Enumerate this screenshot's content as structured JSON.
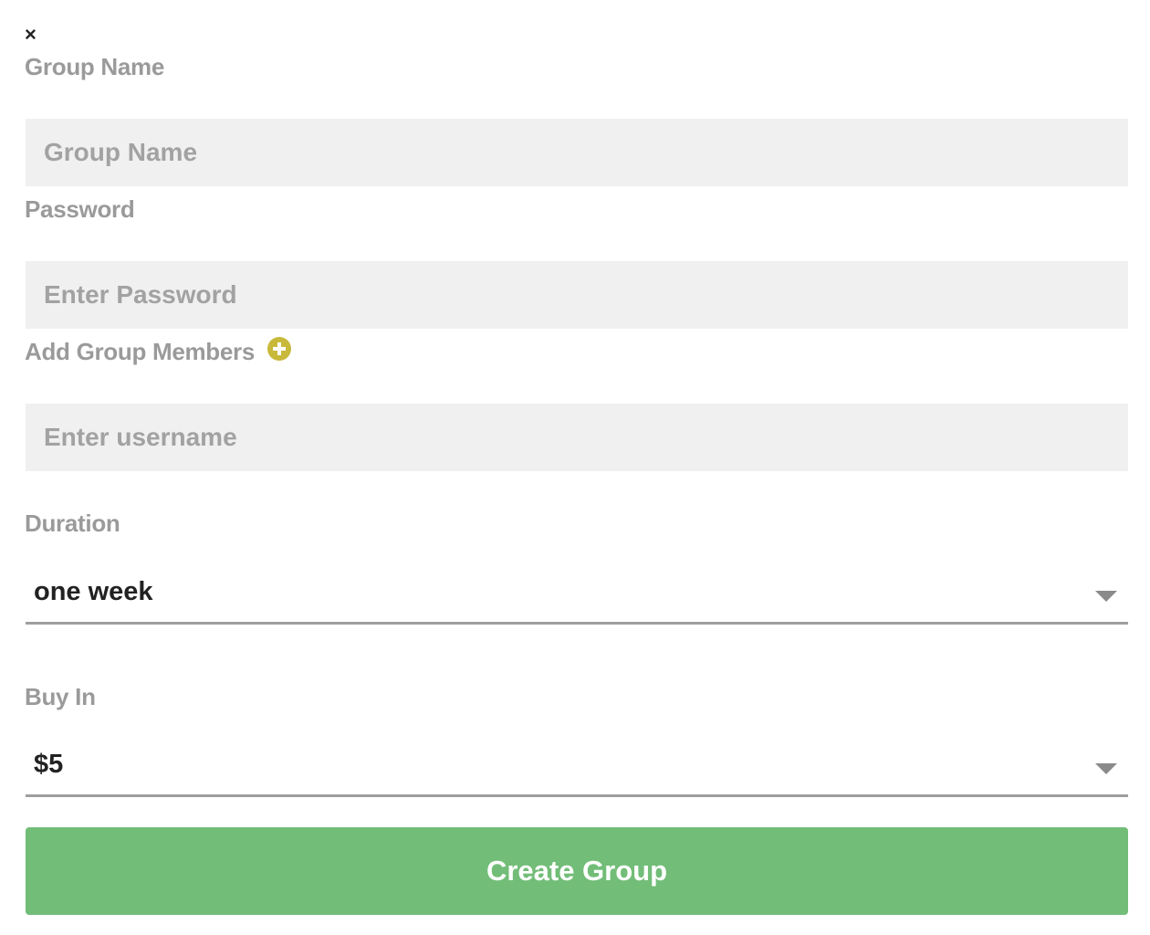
{
  "modal": {
    "close_glyph": "×"
  },
  "group_name": {
    "label": "Group Name",
    "placeholder": "Group Name"
  },
  "password": {
    "label": "Password",
    "placeholder": "Enter Password"
  },
  "members": {
    "label": "Add Group Members",
    "add_icon": "plus-circle-icon",
    "placeholder": "Enter username"
  },
  "duration": {
    "label": "Duration",
    "selected": "one week"
  },
  "buy_in": {
    "label": "Buy In",
    "selected": "$5"
  },
  "actions": {
    "create_label": "Create Group"
  },
  "colors": {
    "accent_green": "#72bd78",
    "add_icon_yellow": "#c9b93a",
    "label_gray": "#9a9a9a",
    "input_bg": "#f0f0f0"
  }
}
